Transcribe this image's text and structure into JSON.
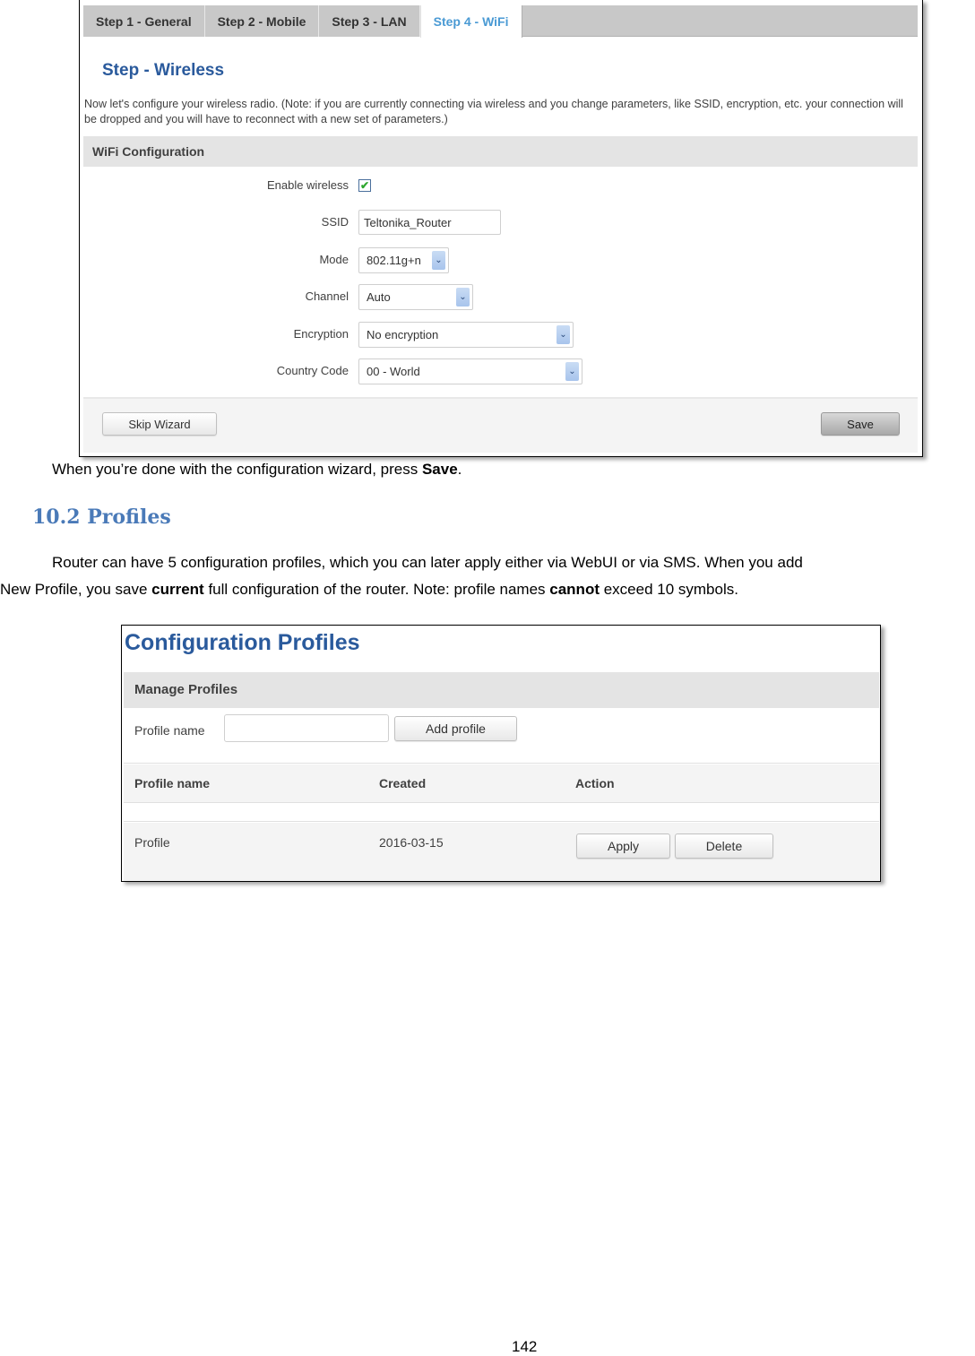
{
  "wizard": {
    "tabs": [
      {
        "label": "Step 1 - General",
        "active": false
      },
      {
        "label": "Step 2 - Mobile",
        "active": false
      },
      {
        "label": "Step 3 - LAN",
        "active": false
      },
      {
        "label": "Step 4 - WiFi",
        "active": true
      }
    ],
    "title": "Step - Wireless",
    "description": "Now let's configure your wireless radio. (Note: if you are currently connecting via wireless and you change parameters, like SSID, encryption, etc. your connection will be dropped and you will have to reconnect with a new set of parameters.)",
    "section_title": "WiFi Configuration",
    "fields": {
      "enable_wireless": {
        "label": "Enable wireless",
        "checked": true,
        "check_glyph": "✔"
      },
      "ssid": {
        "label": "SSID",
        "value": "Teltonika_Router"
      },
      "mode": {
        "label": "Mode",
        "value": "802.11g+n"
      },
      "channel": {
        "label": "Channel",
        "value": "Auto"
      },
      "encryption": {
        "label": "Encryption",
        "value": "No encryption"
      },
      "country_code": {
        "label": "Country Code",
        "value": "00 - World"
      }
    },
    "dropdown_glyph": "⌄",
    "skip_label": "Skip Wizard",
    "save_label": "Save"
  },
  "doc": {
    "done_text_prefix": "When you’re done with the configuration wizard, press ",
    "done_text_bold": "Save",
    "done_text_suffix": ".",
    "section_heading": "10.2 Profiles",
    "para_line1": "Router can have 5 configuration profiles, which you can later apply either via WebUI or via SMS. When you add",
    "para_line2_a": "New Profile, you save ",
    "para_line2_b": "current",
    "para_line2_c": " full configuration of the router. Note: profile names ",
    "para_line2_d": "cannot",
    "para_line2_e": " exceed 10 symbols.",
    "page_number": "142"
  },
  "profiles": {
    "title": "Configuration Profiles",
    "section_title": "Manage Profiles",
    "name_label": "Profile name",
    "name_value": "",
    "add_label": "Add profile",
    "columns": [
      "Profile name",
      "Created",
      "Action"
    ],
    "rows": [
      {
        "name": "Profile",
        "created": "2016-03-15",
        "apply_label": "Apply",
        "delete_label": "Delete"
      }
    ]
  }
}
